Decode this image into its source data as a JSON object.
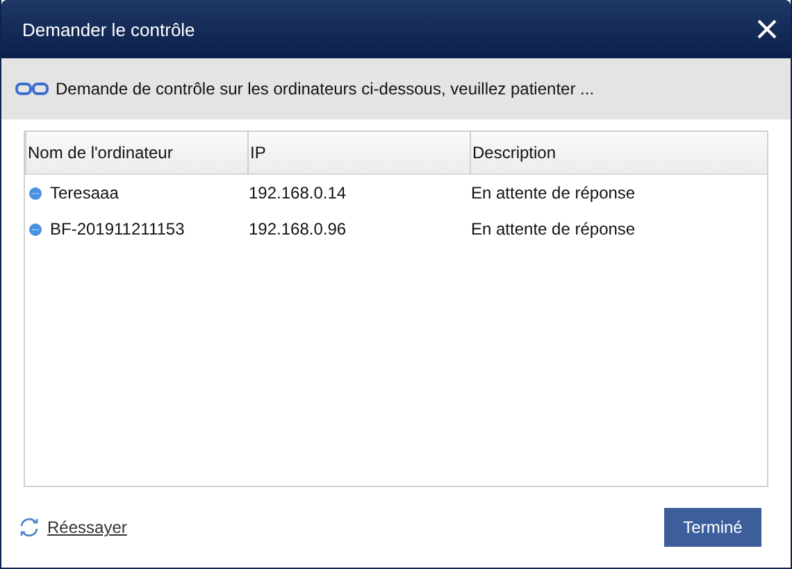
{
  "window": {
    "title": "Demander le contrôle"
  },
  "info": {
    "message": "Demande de contrôle sur les ordinateurs ci-dessous, veuillez patienter ..."
  },
  "table": {
    "columns": [
      "Nom de l'ordinateur",
      "IP",
      "Description"
    ],
    "rows": [
      {
        "name": "Teresaaa",
        "ip": "192.168.0.14",
        "description": "En attente de réponse"
      },
      {
        "name": "BF-201911211153",
        "ip": "192.168.0.96",
        "description": "En attente de réponse"
      }
    ]
  },
  "footer": {
    "retry": "Réessayer",
    "done": "Terminé"
  }
}
